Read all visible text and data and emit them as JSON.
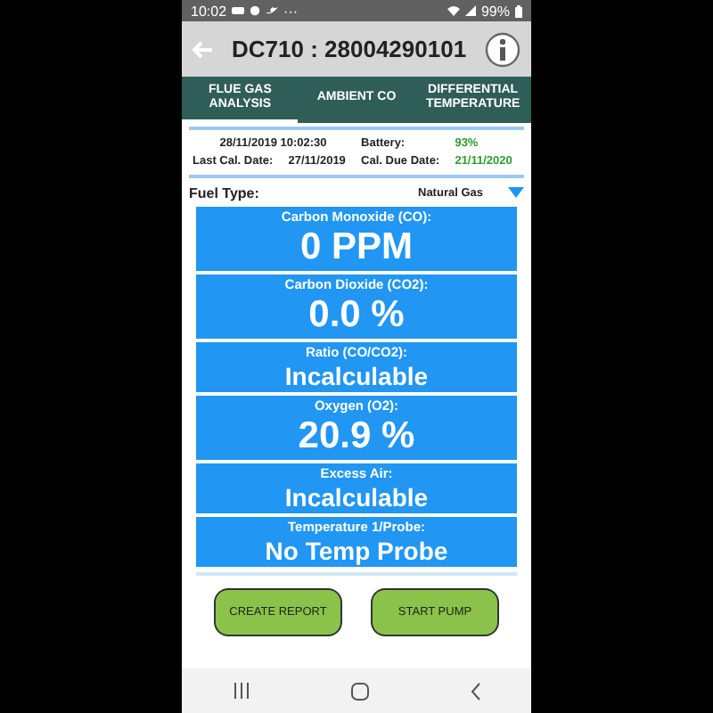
{
  "status_bar": {
    "time": "10:02",
    "more": "···",
    "battery": "99%"
  },
  "app_bar": {
    "title": "DC710 : 28004290101"
  },
  "tabs": [
    {
      "label": "FLUE GAS\nANALYSIS",
      "selected": true
    },
    {
      "label": "AMBIENT CO",
      "selected": false
    },
    {
      "label": "DIFFERENTIAL\nTEMPERATURE",
      "selected": false
    }
  ],
  "info": {
    "datetime": "28/11/2019 10:02:30",
    "battery_label": "Battery:",
    "battery_value": "93%",
    "last_cal_label": "Last Cal. Date:",
    "last_cal_value": "27/11/2019",
    "cal_due_label": "Cal. Due Date:",
    "cal_due_value": "21/11/2020"
  },
  "fuel": {
    "label": "Fuel Type:",
    "value": "Natural Gas"
  },
  "readings": [
    {
      "label": "Carbon Monoxide (CO):",
      "value": "0 PPM",
      "kind": "large"
    },
    {
      "label": "Carbon Dioxide (CO2):",
      "value": "0.0 %",
      "kind": "large"
    },
    {
      "label": "Ratio (CO/CO2):",
      "value": "Incalculable",
      "kind": "medium"
    },
    {
      "label": "Oxygen (O2):",
      "value": "20.9 %",
      "kind": "large"
    },
    {
      "label": "Excess Air:",
      "value": "Incalculable",
      "kind": "medium"
    },
    {
      "label": "Temperature 1/Probe:",
      "value": "No Temp Probe",
      "kind": "medium"
    }
  ],
  "buttons": [
    "CREATE REPORT",
    "START PUMP"
  ]
}
